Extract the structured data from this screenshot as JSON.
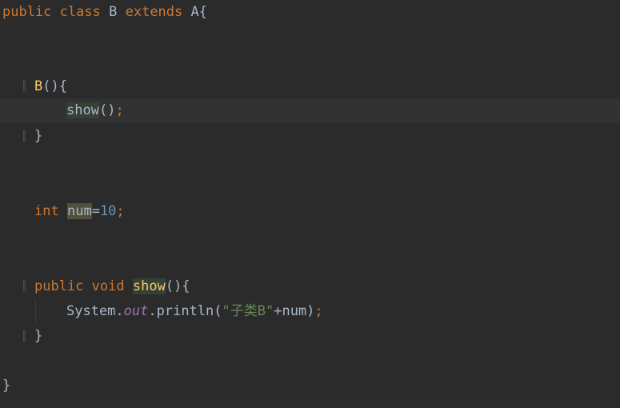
{
  "code": {
    "line1": {
      "kw_public": "public",
      "kw_class": "class",
      "class_name": "B",
      "kw_extends": "extends",
      "parent_open": "A{"
    },
    "line_ctor": {
      "ctor": "B",
      "parens": "(){"
    },
    "line_call": {
      "call": "show",
      "parens": "()",
      "semi": ";"
    },
    "line_ctor_close": "}",
    "line_field": {
      "kw_int": "int",
      "var": "num",
      "eq": "=",
      "value": "10",
      "semi": ";"
    },
    "line_method": {
      "kw_public": "public",
      "kw_void": "void",
      "name": "show",
      "parens": "(){"
    },
    "line_print": {
      "obj": "System.",
      "field": "out",
      "dot_method": ".println(",
      "string": "\"子类B\"",
      "concat": "+num)",
      "semi": ";"
    },
    "line_method_close": "}",
    "line_class_close": "}"
  },
  "colors": {
    "background": "#2b2b2b",
    "keyword": "#cc7832",
    "text": "#a9b7c6",
    "method": "#ffc66d",
    "number": "#6897bb",
    "string": "#6a8759",
    "static_field": "#9876aa"
  }
}
